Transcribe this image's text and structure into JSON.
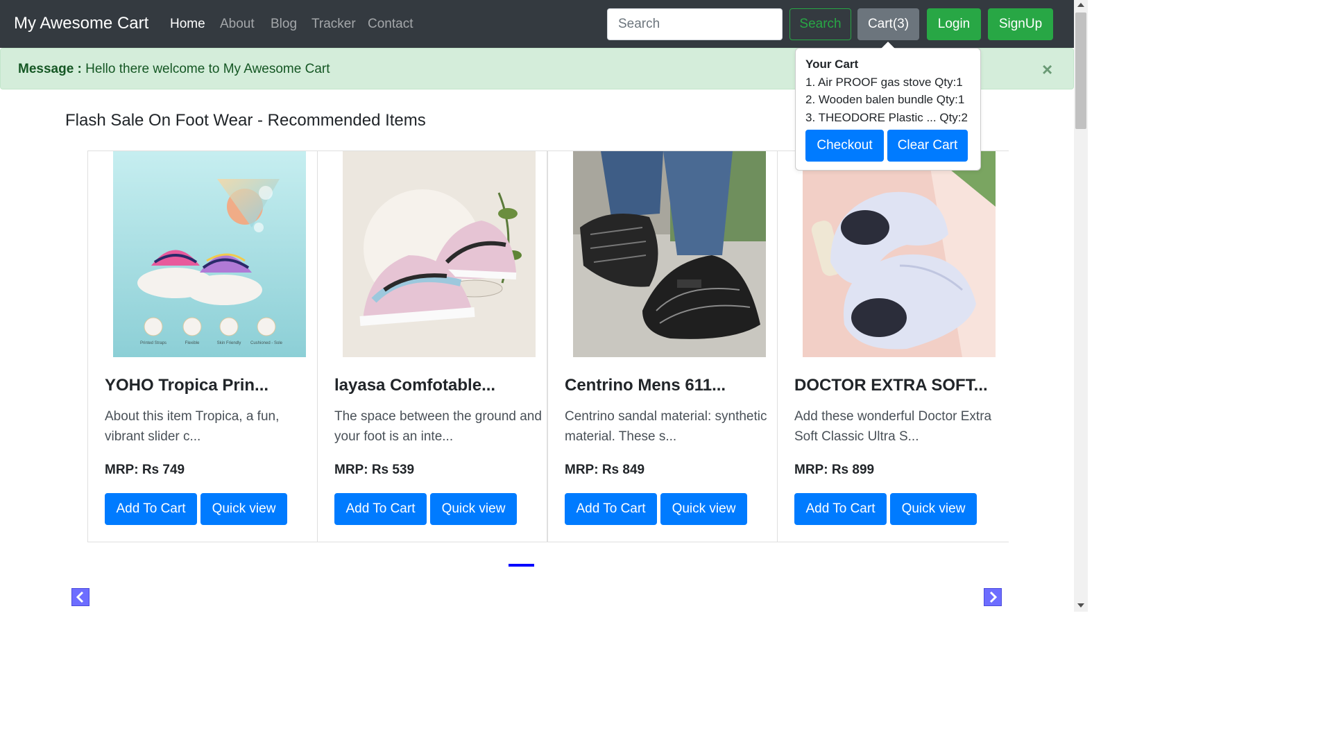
{
  "navbar": {
    "brand": "My Awesome Cart",
    "links": [
      {
        "label": "Home",
        "active": true
      },
      {
        "label": "About",
        "active": false
      },
      {
        "label": "Blog",
        "active": false
      },
      {
        "label": "Tracker",
        "active": false
      },
      {
        "label": "Contact",
        "active": false
      }
    ],
    "search_placeholder": "Search",
    "search_button": "Search",
    "cart_button": "Cart(3)",
    "login_button": "Login",
    "signup_button": "SignUp"
  },
  "alert": {
    "label": "Message :",
    "text": "Hello there welcome to My Awesome Cart",
    "close_glyph": "×"
  },
  "section_title": "Flash Sale On Foot Wear - Recommended Items",
  "products": [
    {
      "title": "YOHO Tropica Prin...",
      "desc": "About this item Tropica, a fun, vibrant slider c...",
      "price": "MRP: Rs 749",
      "add_label": "Add To Cart",
      "quick_label": "Quick view",
      "image_icon": "slider-sandal-image",
      "image_captions": [
        "Printed Straps",
        "Flexible",
        "Skin Friendly",
        "Cushioned - Sole"
      ]
    },
    {
      "title": "layasa Comfotable...",
      "desc": "The space between the ground and your foot is an inte...",
      "price": "MRP: Rs 539",
      "add_label": "Add To Cart",
      "quick_label": "Quick view",
      "image_icon": "sneaker-image"
    },
    {
      "title": "Centrino Mens 611...",
      "desc": "Centrino sandal material: synthetic material. These s...",
      "price": "MRP: Rs 849",
      "add_label": "Add To Cart",
      "quick_label": "Quick view",
      "image_icon": "leather-sandal-image"
    },
    {
      "title": "DOCTOR EXTRA SOFT...",
      "desc": "Add these wonderful Doctor Extra Soft Classic Ultra S...",
      "price": "MRP: Rs 899",
      "add_label": "Add To Cart",
      "quick_label": "Quick view",
      "image_icon": "soft-slider-image"
    }
  ],
  "cart_popover": {
    "title": "Your Cart",
    "items": [
      "1. Air PROOF gas stove Qty:1",
      "2. Wooden balen bundle Qty:1",
      "3. THEODORE Plastic ... Qty:2"
    ],
    "checkout_label": "Checkout",
    "clear_label": "Clear Cart"
  },
  "colors": {
    "navbar_bg": "#343a40",
    "success": "#28a745",
    "primary": "#007bff",
    "alert_bg": "#d4edda",
    "indicator": "#0000ff"
  }
}
